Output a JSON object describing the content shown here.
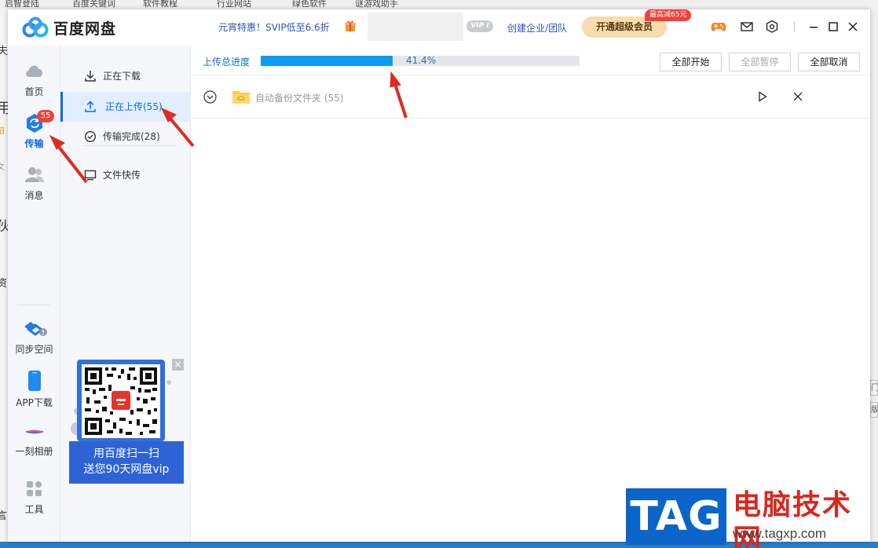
{
  "background": {
    "tabs": [
      "启智登陆",
      "百度关键词",
      "软件教程",
      "行业网站",
      "绿色软件",
      "谜游戏助手"
    ],
    "left_chars": [
      "夫",
      "用",
      "招",
      "文",
      "伙",
      "资",
      "言"
    ],
    "right_buttons": [
      "门",
      "版"
    ]
  },
  "titlebar": {
    "app_title": "百度网盘",
    "promo_text": "元宵特惠！SVIP低至6.6折",
    "vip_badge": "VIP I",
    "enterprise_link": "创建企业/团队",
    "svip_button": "开通超级会员",
    "svip_tag": "最高减65元"
  },
  "nav": {
    "home": "首页",
    "transfer": "传输",
    "transfer_badge": "55",
    "messages": "消息",
    "sync": "同步空间",
    "app_download": "APP下载",
    "album": "一刻相册",
    "tools": "工具"
  },
  "subnav": {
    "downloading": "正在下载",
    "uploading": "正在上传(55)",
    "completed": "传输完成(28)",
    "quick_transfer": "文件快传"
  },
  "qr_promo": {
    "line1": "用百度扫一扫",
    "line2": "送您90天网盘vip",
    "close": "×"
  },
  "progress": {
    "label": "上传总进度",
    "percent_text": "41.4%",
    "fraction": 0.414,
    "start_all": "全部开始",
    "pause_all": "全部暂停",
    "cancel_all": "全部取消"
  },
  "tasks": [
    {
      "name": "自动备份文件夹  (55)"
    }
  ],
  "watermark": {
    "tag": "TAG",
    "site_name": "电脑技术网",
    "url": "www.tagxp.com"
  },
  "colors": {
    "accent": "#0b6de0",
    "progress_fill": "#0a9cf2",
    "badge_red": "#f0423a",
    "svip_gold": "#f7dcae",
    "arrow_red": "#e02a1f"
  }
}
